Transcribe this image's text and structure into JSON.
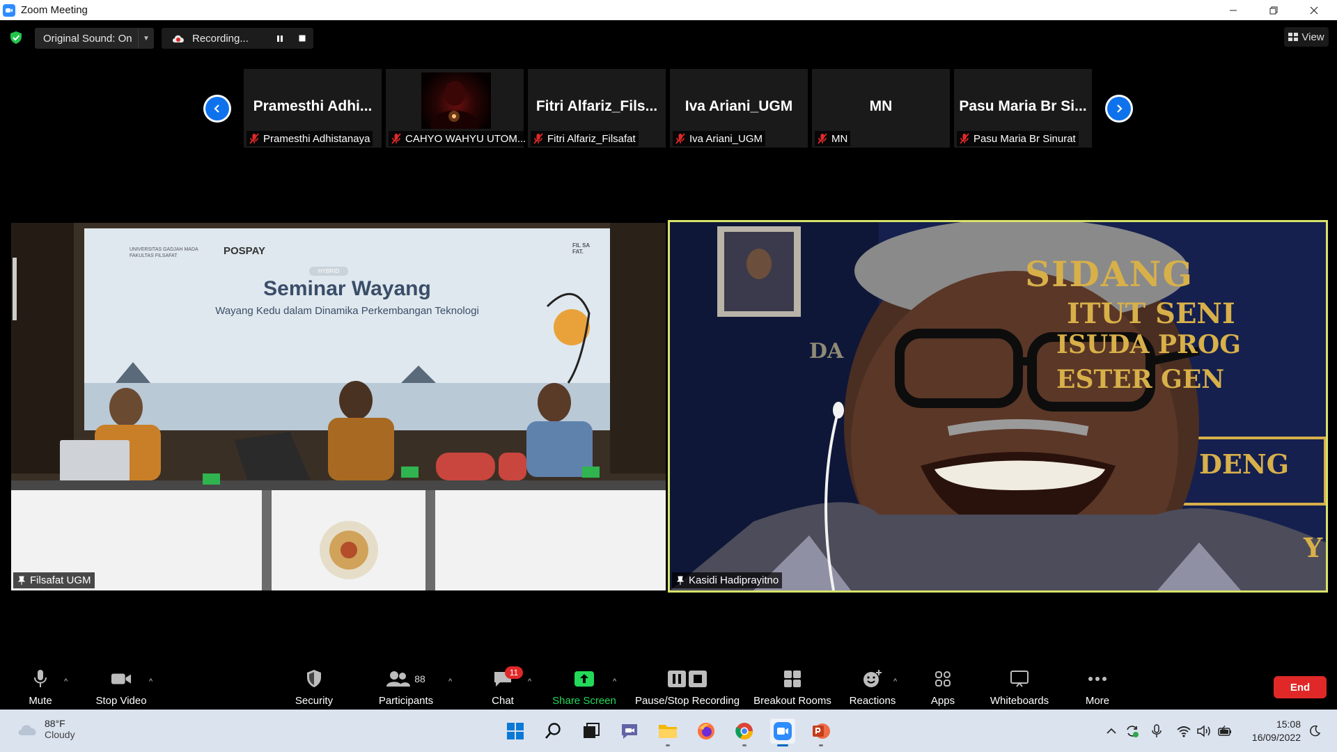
{
  "window": {
    "title": "Zoom Meeting"
  },
  "topbar": {
    "original_sound": "Original Sound: On",
    "recording": "Recording...",
    "view": "View"
  },
  "thumbnails": [
    {
      "display": "Pramesthi  Adhi...",
      "label": "Pramesthi Adhistanaya",
      "muted": true,
      "video": false
    },
    {
      "display": "",
      "label": "CAHYO WAHYU UTOM...",
      "muted": true,
      "video": true
    },
    {
      "display": "Fitri  Alfariz_Fils...",
      "label": "Fitri Alfariz_Filsafat",
      "muted": true,
      "video": false
    },
    {
      "display": "Iva Ariani_UGM",
      "label": "Iva Ariani_UGM",
      "muted": true,
      "video": false
    },
    {
      "display": "MN",
      "label": "MN",
      "muted": true,
      "video": false
    },
    {
      "display": "Pasu  Maria  Br  Si...",
      "label": "Pasu Maria Br Sinurat",
      "muted": true,
      "video": false
    }
  ],
  "main_videos": {
    "left": {
      "name": "Filsafat UGM",
      "banner": {
        "org": "UNIVERSITAS GADJAH MADA\nFAKULTAS FILSAFAT",
        "sponsor": "POSPAY",
        "tag": "HYBRID",
        "logo_text": "FIL SA FAT.",
        "title": "Seminar Wayang",
        "subtitle": "Wayang Kedu dalam Dinamika Perkembangan Teknologi"
      }
    },
    "right": {
      "name": "Kasidi Hadiprayitno",
      "banner_lines": [
        "SIDANG",
        "ITUT SENI",
        "DA",
        "ISUDA PROG",
        "ESTER GEN",
        "DENG",
        "Y"
      ]
    }
  },
  "toolbar": {
    "mute": "Mute",
    "stop_video": "Stop Video",
    "security": "Security",
    "participants": "Participants",
    "participants_count": "88",
    "chat": "Chat",
    "chat_badge": "11",
    "share_screen": "Share Screen",
    "pause_stop_recording": "Pause/Stop Recording",
    "breakout_rooms": "Breakout Rooms",
    "reactions": "Reactions",
    "apps": "Apps",
    "whiteboards": "Whiteboards",
    "more": "More",
    "end": "End"
  },
  "taskbar": {
    "weather_temp": "88°F",
    "weather_cond": "Cloudy",
    "time": "15:08",
    "date": "16/09/2022"
  },
  "colors": {
    "zoom_blue": "#0E72ED",
    "active_speaker": "#d8e36a",
    "end_red": "#e02828",
    "share_green": "#23d959"
  }
}
